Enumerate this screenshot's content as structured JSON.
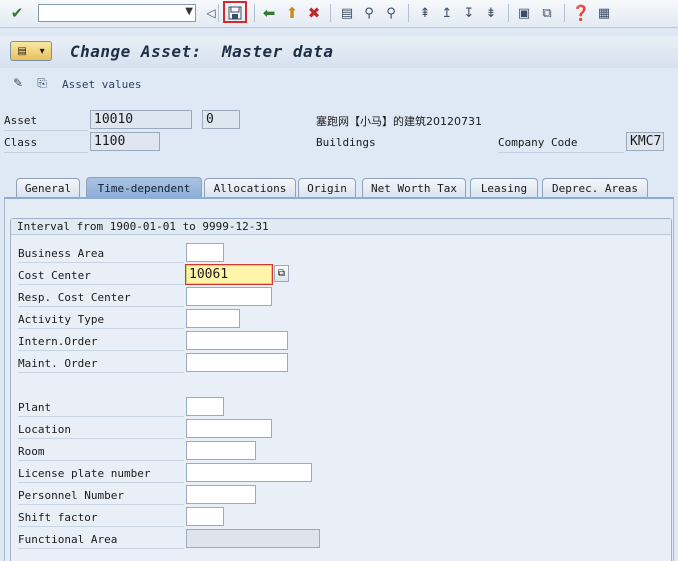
{
  "toolbar": {
    "command_field_value": "",
    "icons": [
      "enter-icon",
      "command-field",
      "back-nav-icon",
      "save-icon",
      "back-icon",
      "exit-icon",
      "cancel-icon",
      "print-icon",
      "find-icon",
      "find-next-icon",
      "first-page-icon",
      "previous-page-icon",
      "next-page-icon",
      "last-page-icon",
      "create-session-icon",
      "shortcut-icon",
      "help-icon",
      "customize-layout-icon"
    ],
    "highlight_color": "#d62a2a"
  },
  "title": "Change Asset:  Master data",
  "app_toolbar": {
    "asset_values_label": "Asset values"
  },
  "header": {
    "asset_label": "Asset",
    "asset_number": "10010",
    "asset_subnumber": "0",
    "asset_description": "塞跑网【小马】的建筑20120731",
    "class_label": "Class",
    "class_value": "1100",
    "class_description": "Buildings",
    "company_code_label": "Company Code",
    "company_code_value": "KMC7"
  },
  "tabs": [
    {
      "label": "General",
      "active": false
    },
    {
      "label": "Time-dependent",
      "active": true
    },
    {
      "label": "Allocations",
      "active": false
    },
    {
      "label": "Origin",
      "active": false
    },
    {
      "label": "Net Worth Tax",
      "active": false
    },
    {
      "label": "Leasing",
      "active": false
    },
    {
      "label": "Deprec. Areas",
      "active": false
    }
  ],
  "interval": "Interval from 1900-01-01 to 9999-12-31",
  "fields": {
    "business_area": {
      "label": "Business Area",
      "value": ""
    },
    "cost_center": {
      "label": "Cost Center",
      "value": "10061"
    },
    "resp_cost_center": {
      "label": "Resp. Cost Center",
      "value": ""
    },
    "activity_type": {
      "label": "Activity Type",
      "value": ""
    },
    "intern_order": {
      "label": "Intern.Order",
      "value": ""
    },
    "maint_order": {
      "label": "Maint. Order",
      "value": ""
    },
    "plant": {
      "label": "Plant",
      "value": ""
    },
    "location": {
      "label": "Location",
      "value": ""
    },
    "room": {
      "label": "Room",
      "value": ""
    },
    "license_plate": {
      "label": "License plate number",
      "value": ""
    },
    "personnel_number": {
      "label": "Personnel Number",
      "value": ""
    },
    "shift_factor": {
      "label": "Shift factor",
      "value": ""
    },
    "functional_area": {
      "label": "Functional Area",
      "value": ""
    }
  }
}
